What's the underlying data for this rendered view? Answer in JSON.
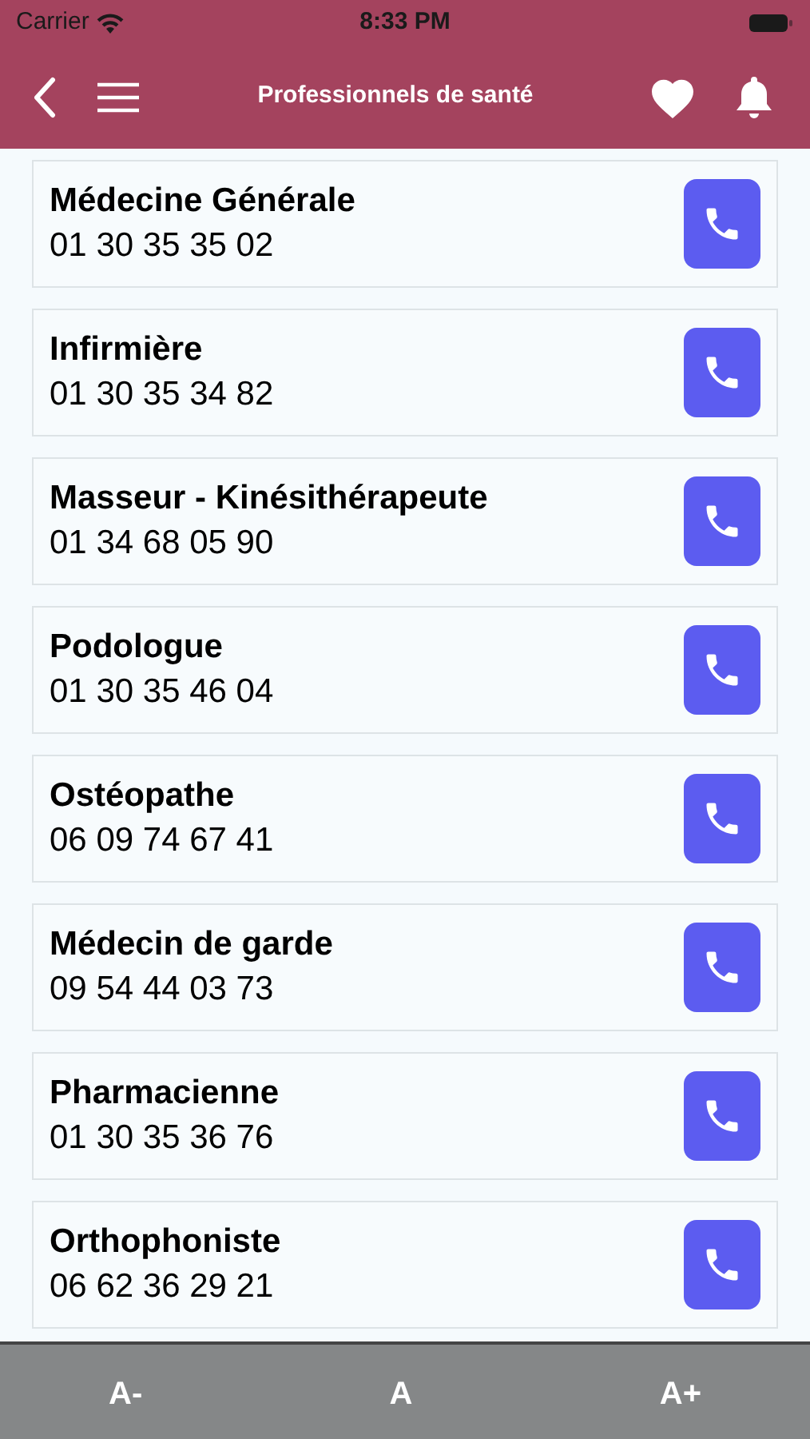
{
  "status_bar": {
    "carrier": "Carrier",
    "time": "8:33 PM"
  },
  "header": {
    "title": "Professionnels de santé"
  },
  "contacts": [
    {
      "name": "Médecine Générale",
      "phone": "01 30 35 35 02"
    },
    {
      "name": "Infirmière",
      "phone": "01 30 35 34 82"
    },
    {
      "name": "Masseur - Kinésithérapeute",
      "phone": "01 34 68 05 90"
    },
    {
      "name": "Podologue",
      "phone": "01 30 35 46 04"
    },
    {
      "name": "Ostéopathe",
      "phone": "06 09 74 67 41"
    },
    {
      "name": "Médecin de garde",
      "phone": "09 54 44 03 73"
    },
    {
      "name": "Pharmacienne",
      "phone": "01 30 35 36 76"
    },
    {
      "name": "Orthophoniste",
      "phone": "06 62 36 29 21"
    }
  ],
  "font_bar": {
    "buttons": [
      "A-",
      "A",
      "A+"
    ]
  }
}
